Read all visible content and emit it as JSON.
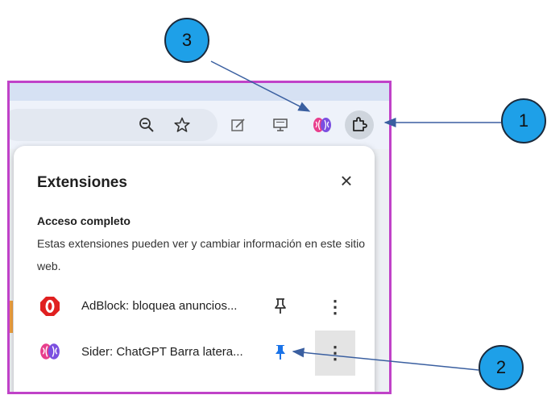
{
  "toolbar": {
    "icons": [
      "zoom-out-icon",
      "star-icon",
      "edit-icon",
      "cast-icon",
      "sider-extension-icon",
      "extensions-puzzle-icon"
    ]
  },
  "popup": {
    "title": "Extensiones",
    "close_label": "×",
    "section_title": "Acceso completo",
    "section_desc": "Estas extensiones pueden ver y cambiar información en este sitio web.",
    "extensions": [
      {
        "label": "AdBlock: bloquea anuncios...",
        "icon": "adblock-icon",
        "pinned": false,
        "more": "⋮"
      },
      {
        "label": "Sider: ChatGPT Barra latera...",
        "icon": "sider-icon",
        "pinned": true,
        "more": "⋮"
      }
    ]
  },
  "callouts": [
    "1",
    "2",
    "3"
  ],
  "colors": {
    "frame_border": "#c042c8",
    "callout_fill": "#1ea0e8",
    "pin_active": "#1a73e8"
  }
}
